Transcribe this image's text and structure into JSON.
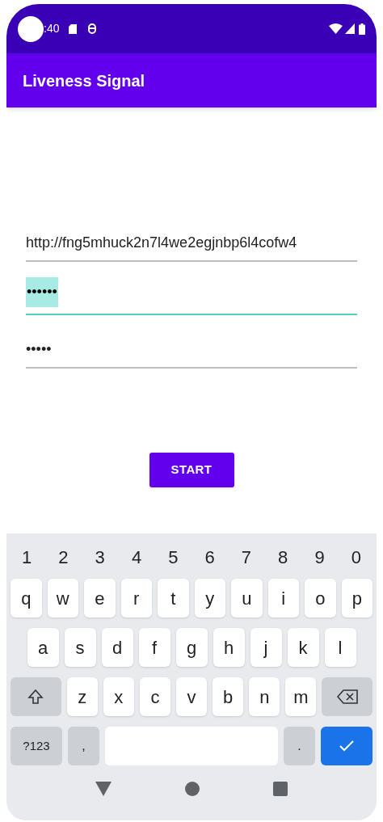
{
  "status_bar": {
    "time": ":40"
  },
  "app_bar": {
    "title": "Liveness Signal"
  },
  "fields": [
    {
      "value": "http://fng5mhuck2n7l4we2egjnbp6l4cofw4",
      "focused": false,
      "selected": false
    },
    {
      "value": "••••••",
      "focused": true,
      "selected": true
    },
    {
      "value": "•••••",
      "focused": false,
      "selected": false
    }
  ],
  "start_button": {
    "label": "START"
  },
  "keyboard": {
    "number_row": [
      "1",
      "2",
      "3",
      "4",
      "5",
      "6",
      "7",
      "8",
      "9",
      "0"
    ],
    "rows": [
      [
        "q",
        "w",
        "e",
        "r",
        "t",
        "y",
        "u",
        "i",
        "o",
        "p"
      ],
      [
        "a",
        "s",
        "d",
        "f",
        "g",
        "h",
        "j",
        "k",
        "l"
      ],
      [
        "z",
        "x",
        "c",
        "v",
        "b",
        "n",
        "m"
      ]
    ],
    "symbols_key": "?123",
    "comma_key": ",",
    "period_key": "."
  }
}
